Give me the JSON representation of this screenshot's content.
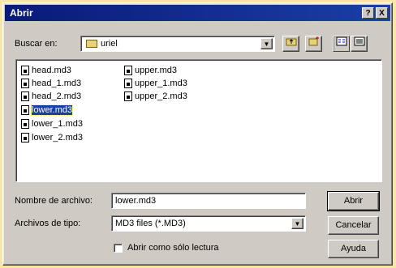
{
  "window": {
    "title": "Abrir",
    "help_label": "?",
    "close_label": "X"
  },
  "location": {
    "label": "Buscar en:",
    "value": "uriel"
  },
  "toolbar": {
    "up_icon": "folder-up-icon",
    "new_folder_icon": "new-folder-icon",
    "list_view_icon": "list-view-icon",
    "details_view_icon": "details-view-icon"
  },
  "files": [
    {
      "name": "head.md3",
      "selected": false
    },
    {
      "name": "head_1.md3",
      "selected": false
    },
    {
      "name": "head_2.md3",
      "selected": false
    },
    {
      "name": "lower.md3",
      "selected": true
    },
    {
      "name": "lower_1.md3",
      "selected": false
    },
    {
      "name": "lower_2.md3",
      "selected": false
    },
    {
      "name": "upper.md3",
      "selected": false
    },
    {
      "name": "upper_1.md3",
      "selected": false
    },
    {
      "name": "upper_2.md3",
      "selected": false
    }
  ],
  "filename": {
    "label": "Nombre de archivo:",
    "value": "lower.md3"
  },
  "filetype": {
    "label": "Archivos de tipo:",
    "value": "MD3 files (*.MD3)"
  },
  "readonly": {
    "label": "Abrir como sólo lectura",
    "checked": false
  },
  "buttons": {
    "open": "Abrir",
    "cancel": "Cancelar",
    "help": "Ayuda"
  },
  "colors": {
    "titlebar": "#0a1a78",
    "face": "#cfcbc4",
    "selection": "#1b3ea6",
    "backdrop": "#f7e6a6"
  }
}
